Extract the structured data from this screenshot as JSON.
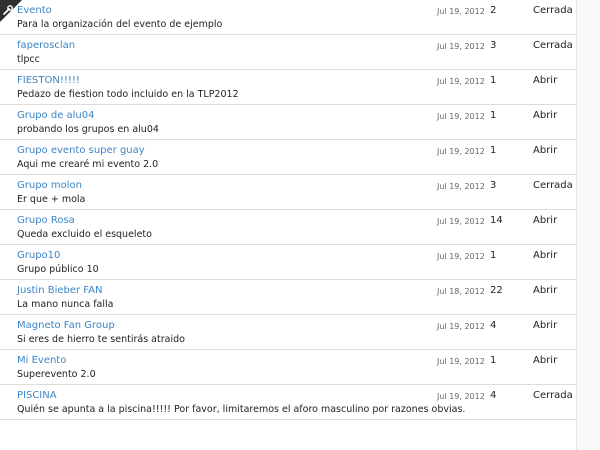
{
  "groups": [
    {
      "name": "Evento",
      "description": "Para la organización del evento de ejemplo",
      "date": "Jul 19, 2012",
      "count": "2",
      "status": "Cerrada"
    },
    {
      "name": "faperosclan",
      "description": "tlpcc",
      "date": "Jul 19, 2012",
      "count": "3",
      "status": "Cerrada"
    },
    {
      "name": "FIESTON!!!!!",
      "description": "Pedazo de fiestion todo incluido en la TLP2012",
      "date": "Jul 19, 2012",
      "count": "1",
      "status": "Abrir"
    },
    {
      "name": "Grupo de alu04",
      "description": "probando los grupos en alu04",
      "date": "Jul 19, 2012",
      "count": "1",
      "status": "Abrir"
    },
    {
      "name": "Grupo evento super guay",
      "description": "Aqui me crearé mi evento 2.0",
      "date": "Jul 19, 2012",
      "count": "1",
      "status": "Abrir"
    },
    {
      "name": "Grupo molon",
      "description": "Er que + mola",
      "date": "Jul 19, 2012",
      "count": "3",
      "status": "Cerrada"
    },
    {
      "name": "Grupo Rosa",
      "description": "Queda excluido el esqueleto",
      "date": "Jul 19, 2012",
      "count": "14",
      "status": "Abrir"
    },
    {
      "name": "Grupo10",
      "description": "Grupo público 10",
      "date": "Jul 19, 2012",
      "count": "1",
      "status": "Abrir"
    },
    {
      "name": "Justin Bieber FAN",
      "description": "La mano nunca falla",
      "date": "Jul 18, 2012",
      "count": "22",
      "status": "Abrir"
    },
    {
      "name": "Magneto Fan Group",
      "description": "Si eres de hierro te sentirás atraido",
      "date": "Jul 19, 2012",
      "count": "4",
      "status": "Abrir"
    },
    {
      "name": "Mi Evento",
      "description": "Superevento 2.0",
      "date": "Jul 19, 2012",
      "count": "1",
      "status": "Abrir"
    },
    {
      "name": "PISCINA",
      "description": "Quién se apunta a la piscina!!!!! Por favor, limitaremos el aforo masculino por razones obvias.",
      "date": "Jul 19, 2012",
      "count": "4",
      "status": "Cerrada"
    }
  ],
  "corner_icon": "wrench-icon",
  "colors": {
    "link": "#3d85c6",
    "text": "#222222",
    "muted": "#666666",
    "divider": "#dcdcdc"
  }
}
